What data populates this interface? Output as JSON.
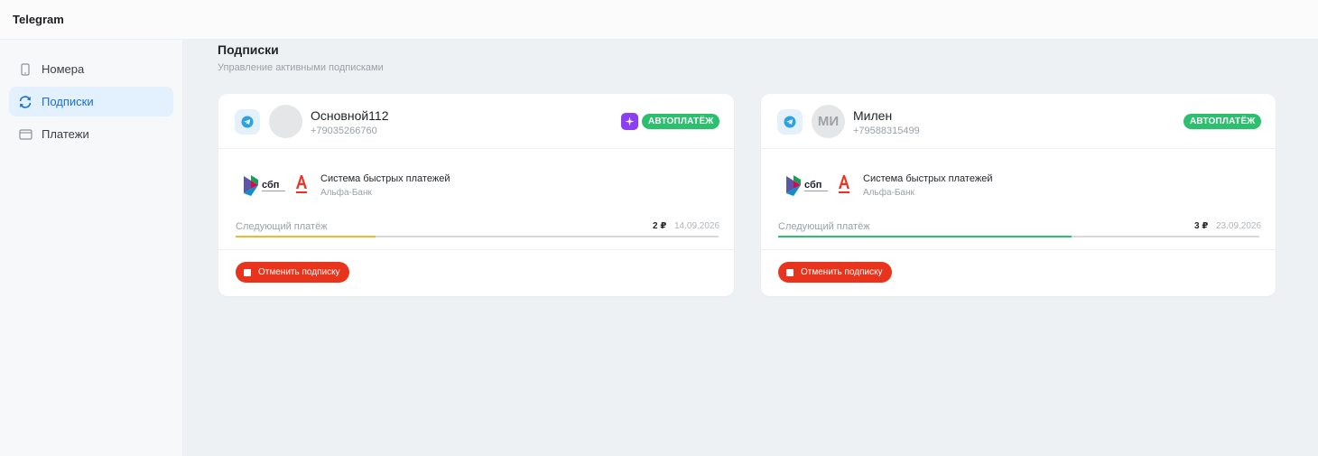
{
  "window": {
    "title": "Telegram"
  },
  "sidebar": {
    "items": [
      {
        "label": "Номера",
        "icon": "phone-icon",
        "active": false
      },
      {
        "label": "Подписки",
        "icon": "refresh-icon",
        "active": true
      },
      {
        "label": "Платежи",
        "icon": "wallet-icon",
        "active": false
      }
    ]
  },
  "page": {
    "title": "Подписки",
    "subtitle": "Управление активными подписками"
  },
  "subscriptions": [
    {
      "service_icon": "telegram-icon",
      "avatar_initials": "",
      "name": "Основной112",
      "phone": "+79035266760",
      "has_spark": true,
      "autopay_label": "АВТОПЛАТЁЖ",
      "payment_method": "Система быстрых платежей",
      "bank": "Альфа-Банк",
      "next_label": "Следующий платёж",
      "amount": "2 ₽",
      "date": "14.09.2026",
      "progress": 0.29,
      "progress_color": "#f2b632",
      "cancel_label": "Отменить подписку"
    },
    {
      "service_icon": "telegram-icon",
      "avatar_initials": "МИ",
      "name": "Милен",
      "phone": "+79588315499",
      "has_spark": false,
      "autopay_label": "АВТОПЛАТЁЖ",
      "payment_method": "Система быстрых платежей",
      "bank": "Альфа-Банк",
      "next_label": "Следующий платёж",
      "amount": "3 ₽",
      "date": "23.09.2026",
      "progress": 0.61,
      "progress_color": "#2bbf6e",
      "cancel_label": "Отменить подписку"
    }
  ],
  "colors": {
    "accent": "#1b6fd1",
    "autopay_green": "#2bbf6e",
    "cancel_red": "#e8341c",
    "spark_purple": "#8b3ff0"
  }
}
